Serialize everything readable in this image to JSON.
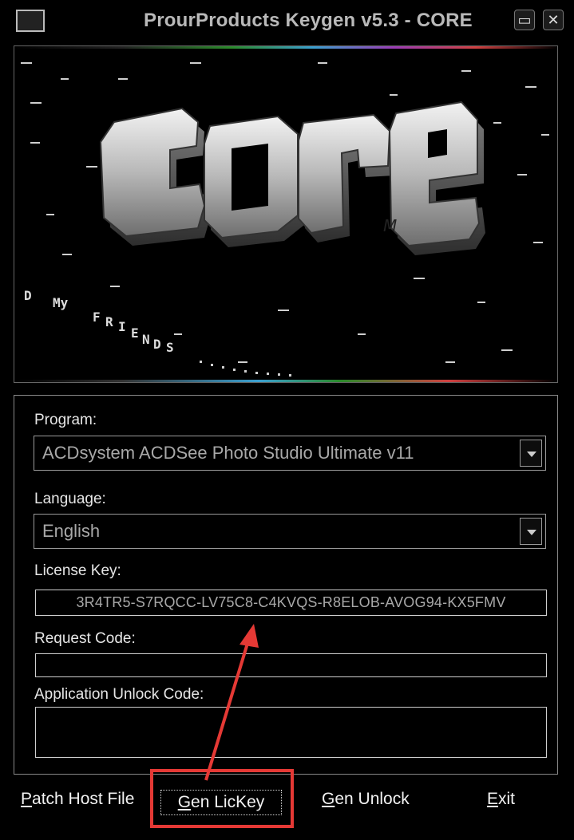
{
  "window": {
    "title": "ProurProducts Keygen v5.3 - CORE",
    "minimize_glyph": "▭",
    "close_glyph": "✕"
  },
  "banner": {
    "logo_text": "core",
    "logo_signature": "M",
    "scroller_text": [
      "D",
      "My",
      "F",
      "R",
      "I",
      "E",
      "N",
      "D",
      "S"
    ],
    "accent_colors": [
      "#2a8a2a",
      "#3aa0d0",
      "#9b3bb5",
      "#d04040"
    ]
  },
  "form": {
    "program_label": "Program:",
    "program_value": "ACDsystem ACDSee Photo Studio Ultimate v11",
    "language_label": "Language:",
    "language_value": "English",
    "license_label": "License Key:",
    "license_value": "3R4TR5-S7RQCC-LV75C8-C4KVQS-R8ELOB-AVOG94-KX5FMV",
    "request_label": "Request Code:",
    "request_value": "",
    "unlock_label": "Application Unlock Code:",
    "unlock_value": ""
  },
  "buttons": {
    "patch_host_first": "P",
    "patch_host_rest": "atch Host File",
    "gen_lickey_first": "G",
    "gen_lickey_rest": "en LicKey",
    "gen_unlock_first": "G",
    "gen_unlock_rest": "en Unlock",
    "exit_first": "E",
    "exit_rest": "xit"
  },
  "annotation": {
    "highlight_color": "#e53935"
  }
}
